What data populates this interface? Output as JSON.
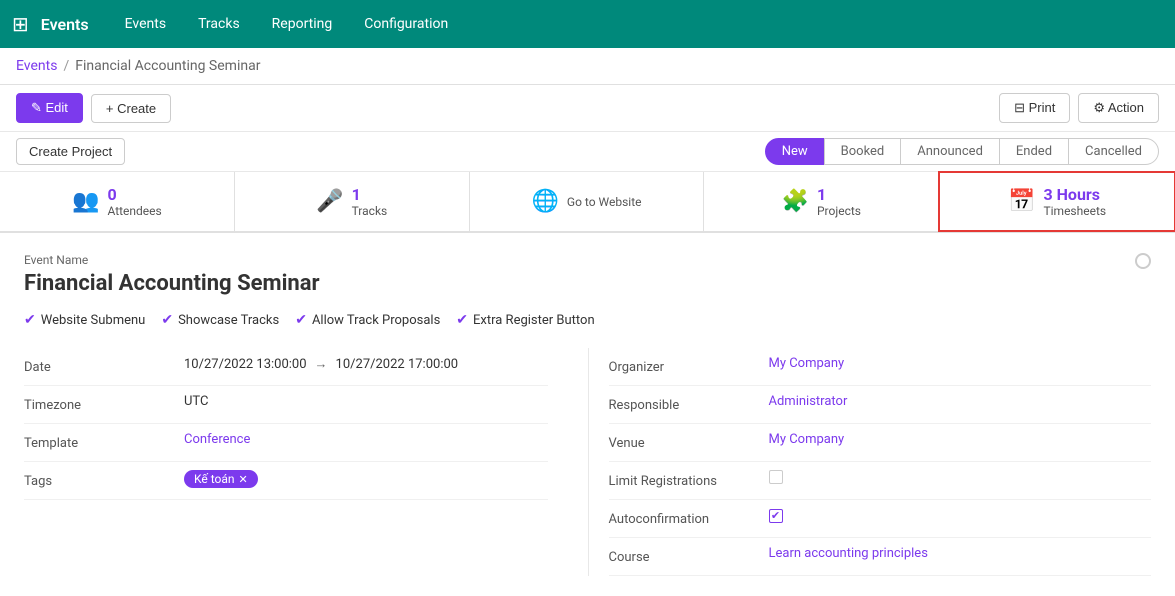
{
  "app": {
    "icon": "⊞",
    "title": "Events"
  },
  "nav": {
    "items": [
      {
        "id": "events",
        "label": "Events"
      },
      {
        "id": "tracks",
        "label": "Tracks"
      },
      {
        "id": "reporting",
        "label": "Reporting"
      },
      {
        "id": "configuration",
        "label": "Configuration"
      }
    ]
  },
  "breadcrumb": {
    "parent": "Events",
    "separator": "/",
    "current": "Financial Accounting Seminar"
  },
  "toolbar": {
    "edit_label": "✎ Edit",
    "create_label": "+ Create",
    "print_label": "⊟ Print",
    "action_label": "⚙ Action"
  },
  "status_bar": {
    "create_project_label": "Create Project",
    "stages": [
      {
        "id": "new",
        "label": "New",
        "active": true
      },
      {
        "id": "booked",
        "label": "Booked",
        "active": false
      },
      {
        "id": "announced",
        "label": "Announced",
        "active": false
      },
      {
        "id": "ended",
        "label": "Ended",
        "active": false
      },
      {
        "id": "cancelled",
        "label": "Cancelled",
        "active": false
      }
    ]
  },
  "stats": [
    {
      "id": "attendees",
      "count": "0",
      "label": "Attendees",
      "icon": "👥"
    },
    {
      "id": "tracks",
      "count": "1",
      "label": "Tracks",
      "icon": "🎤"
    },
    {
      "id": "website",
      "count": "",
      "label": "Go to Website",
      "icon": "🌐"
    },
    {
      "id": "projects",
      "count": "1",
      "label": "Projects",
      "icon": "🧩"
    },
    {
      "id": "timesheets",
      "count": "3 Hours",
      "label": "Timesheets",
      "icon": "📅",
      "highlighted": true
    }
  ],
  "form": {
    "event_name_label": "Event Name",
    "title": "Financial Accounting Seminar",
    "checkboxes": [
      {
        "id": "website_submenu",
        "label": "Website Submenu",
        "checked": true
      },
      {
        "id": "showcase_tracks",
        "label": "Showcase Tracks",
        "checked": true
      },
      {
        "id": "allow_track_proposals",
        "label": "Allow Track Proposals",
        "checked": true
      },
      {
        "id": "extra_register_button",
        "label": "Extra Register Button",
        "checked": true
      }
    ],
    "left_fields": [
      {
        "id": "date",
        "label": "Date",
        "value_type": "date_range",
        "date_start": "10/27/2022 13:00:00",
        "date_end": "10/27/2022 17:00:00"
      },
      {
        "id": "timezone",
        "label": "Timezone",
        "value": "UTC"
      },
      {
        "id": "template",
        "label": "Template",
        "value": "Conference",
        "is_link": true
      },
      {
        "id": "tags",
        "label": "Tags",
        "value_type": "tags",
        "tags": [
          {
            "label": "Kế toán"
          }
        ]
      }
    ],
    "right_fields": [
      {
        "id": "organizer",
        "label": "Organizer",
        "value": "My Company",
        "is_link": true
      },
      {
        "id": "responsible",
        "label": "Responsible",
        "value": "Administrator",
        "is_link": true
      },
      {
        "id": "venue",
        "label": "Venue",
        "value": "My Company",
        "is_link": true
      },
      {
        "id": "limit_registrations",
        "label": "Limit Registrations",
        "value_type": "checkbox",
        "checked": false
      },
      {
        "id": "autoconfirmation",
        "label": "Autoconfirmation",
        "value_type": "checkbox_checked",
        "checked": true
      },
      {
        "id": "course",
        "label": "Course",
        "value": "Learn accounting principles",
        "is_link": true
      }
    ]
  }
}
